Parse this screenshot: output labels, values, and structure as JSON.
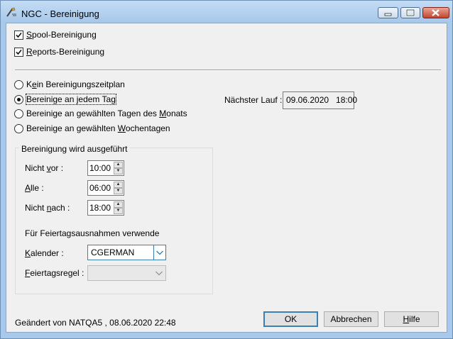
{
  "window": {
    "title": "NGC - Bereinigung"
  },
  "cleanup": {
    "spool": {
      "pre": "",
      "mnemonic": "S",
      "post": "pool-Bereinigung",
      "checked": true
    },
    "reports": {
      "pre": "",
      "mnemonic": "R",
      "post": "eports-Bereinigung",
      "checked": true
    }
  },
  "schedule": {
    "options": [
      {
        "pre": "K",
        "mnemonic": "e",
        "post": "in Bereinigungszeitplan",
        "selected": false
      },
      {
        "pre": "Bereinige an ",
        "mnemonic": "j",
        "post": "edem Tag",
        "selected": true
      },
      {
        "pre": "Bereinige an gewählten Tagen des ",
        "mnemonic": "M",
        "post": "onats",
        "selected": false
      },
      {
        "pre": "Bereinige an gewählten ",
        "mnemonic": "W",
        "post": "ochentagen",
        "selected": false
      }
    ],
    "next_run_label": "Nächster Lauf :",
    "next_run_value": "09.06.2020   18:00"
  },
  "execution": {
    "group_title": "Bereinigung wird ausgeführt",
    "not_before": {
      "pre": "Nicht ",
      "mnemonic": "v",
      "post": "or :",
      "value": "10:00"
    },
    "every": {
      "pre": "",
      "mnemonic": "A",
      "post": "lle :",
      "value": "06:00"
    },
    "not_after": {
      "pre": "Nicht ",
      "mnemonic": "n",
      "post": "ach :",
      "value": "18:00"
    },
    "holiday_heading": "Für Feiertagsausnahmen verwende",
    "calendar": {
      "pre": "",
      "mnemonic": "K",
      "post": "alender :",
      "value": "CGERMAN"
    },
    "holiday_rule": {
      "pre": "",
      "mnemonic": "F",
      "post": "eiertagsregel :",
      "value": ""
    }
  },
  "footer": {
    "changed_by": "Geändert von NATQA5 , 08.06.2020 22:48",
    "ok_label": "OK",
    "cancel_label": "Abbrechen",
    "help": {
      "pre": "",
      "mnemonic": "H",
      "post": "ilfe"
    }
  },
  "icons": [
    "app-icon",
    "minimize-icon",
    "maximize-icon",
    "close-icon",
    "chevron-down-icon",
    "arrow-up-icon",
    "arrow-down-icon"
  ]
}
